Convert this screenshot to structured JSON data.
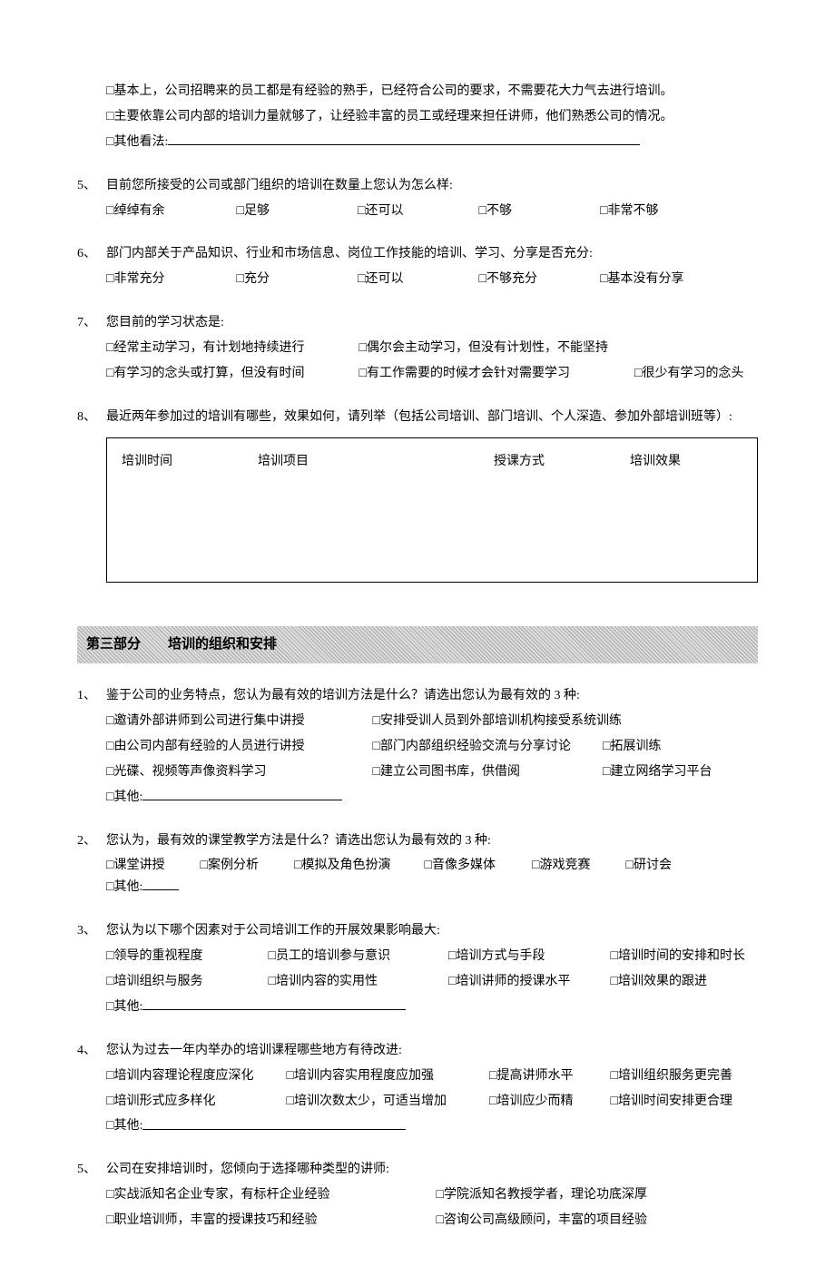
{
  "intro_opts": {
    "a": "基本上，公司招聘来的员工都是有经验的熟手，已经符合公司的要求，不需要花大力气去进行培训。",
    "b": "主要依靠公司内部的培训力量就够了，让经验丰富的员工或经理来担任讲师，他们熟悉公司的情况。",
    "c": "其他看法:"
  },
  "q5": {
    "num": "5、",
    "text": "目前您所接受的公司或部门组织的培训在数量上您认为怎么样:",
    "opts": [
      "绰绰有余",
      "足够",
      "还可以",
      "不够",
      "非常不够"
    ]
  },
  "q6": {
    "num": "6、",
    "text": "部门内部关于产品知识、行业和市场信息、岗位工作技能的培训、学习、分享是否充分:",
    "opts": [
      "非常充分",
      "充分",
      "还可以",
      "不够充分",
      "基本没有分享"
    ]
  },
  "q7": {
    "num": "7、",
    "text": "您目前的学习状态是:",
    "opts": [
      "经常主动学习，有计划地持续进行",
      "偶尔会主动学习，但没有计划性，不能坚持",
      "有学习的念头或打算，但没有时间",
      "有工作需要的时候才会针对需要学习",
      "很少有学习的念头"
    ]
  },
  "q8": {
    "num": "8、",
    "text": "最近两年参加过的培训有哪些，效果如何，请列举（包括公司培训、部门培训、个人深造、参加外部培训班等）:",
    "cols": [
      "培训时间",
      "培训项目",
      "授课方式",
      "培训效果"
    ]
  },
  "section3": "第三部分　　培训的组织和安排",
  "p3q1": {
    "num": "1、",
    "text": "鉴于公司的业务特点，您认为最有效的培训方法是什么？请选出您认为最有效的 3 种:",
    "opts": [
      "邀请外部讲师到公司进行集中讲授",
      "安排受训人员到外部培训机构接受系统训练",
      "由公司内部有经验的人员进行讲授",
      "部门内部组织经验交流与分享讨论",
      "拓展训练",
      "光碟、视频等声像资料学习",
      "建立公司图书库，供借阅",
      "建立网络学习平台",
      "其他:"
    ]
  },
  "p3q2": {
    "num": "2、",
    "text": "您认为，最有效的课堂教学方法是什么？请选出您认为最有效的 3 种:",
    "opts": [
      "课堂讲授",
      "案例分析",
      "模拟及角色扮演",
      "音像多媒体",
      "游戏竞赛",
      "研讨会",
      "其他:"
    ]
  },
  "p3q3": {
    "num": "3、",
    "text": "您认为以下哪个因素对于公司培训工作的开展效果影响最大:",
    "opts": [
      "领导的重视程度",
      "员工的培训参与意识",
      "培训方式与手段",
      "培训时间的安排和时长",
      "培训组织与服务",
      "培训内容的实用性",
      "培训讲师的授课水平",
      "培训效果的跟进",
      "其他:"
    ]
  },
  "p3q4": {
    "num": "4、",
    "text": "您认为过去一年内举办的培训课程哪些地方有待改进:",
    "opts": [
      "培训内容理论程度应深化",
      "培训内容实用程度应加强",
      "提高讲师水平",
      "培训组织服务更完善",
      "培训形式应多样化",
      "培训次数太少，可适当增加",
      "培训应少而精",
      "培训时间安排更合理",
      "其他:"
    ]
  },
  "p3q5": {
    "num": "5、",
    "text": "公司在安排培训时，您倾向于选择哪种类型的讲师:",
    "opts": [
      "实战派知名企业专家，有标杆企业经验",
      "学院派知名教授学者，理论功底深厚",
      "职业培训师，丰富的授课技巧和经验",
      "咨询公司高级顾问，丰富的项目经验"
    ]
  },
  "box": "□ "
}
